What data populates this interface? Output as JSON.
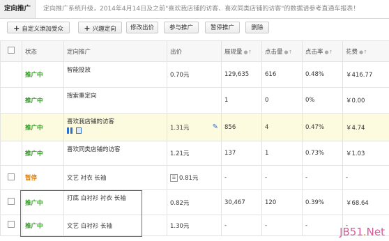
{
  "header": {
    "active_tab": "定向推广",
    "notice": "定向推广系统升级，2014年4月14日及之前\"喜欢我店铺的访客、喜欢同类店铺的访客\"的数据请参考直通车报表！"
  },
  "toolbar": {
    "add_custom": "自定义添加受众",
    "add_interest": "兴趣定向",
    "edit_bid": "修改出价",
    "join": "参与推广",
    "pause": "暂停推广",
    "delete": "删除"
  },
  "table": {
    "headers": [
      "状态",
      "定向推广",
      "出价",
      "展现量",
      "点击量",
      "点击率",
      "花费"
    ],
    "rows": [
      {
        "status": "推广中",
        "status_type": "on",
        "name": "智能投放",
        "bid": "0.70元",
        "impressions": "129,635",
        "clicks": "616",
        "ctr": "0.48%",
        "cost": "￥416.77",
        "checkbox": false
      },
      {
        "status": "推广中",
        "status_type": "on",
        "name": "搜索重定向",
        "bid": "",
        "impressions": "1",
        "clicks": "0",
        "ctr": "0%",
        "cost": "￥0.00",
        "checkbox": false
      },
      {
        "status": "推广中",
        "status_type": "on",
        "name": "喜欢我店铺的访客",
        "bid": "1.31元",
        "impressions": "856",
        "clicks": "4",
        "ctr": "0.47%",
        "cost": "￥4.74",
        "checkbox": false
      },
      {
        "status": "推广中",
        "status_type": "on",
        "name": "喜欢同类店铺的访客",
        "bid": "1.21元",
        "impressions": "137",
        "clicks": "1",
        "ctr": "0.73%",
        "cost": "￥1.03",
        "checkbox": false
      },
      {
        "status": "暂停",
        "status_type": "pause",
        "name": "文艺 衬衣 长袖",
        "bid": "0.81元",
        "impressions": "-",
        "clicks": "-",
        "ctr": "-",
        "cost": "-",
        "checkbox": true
      },
      {
        "status": "推广中",
        "status_type": "on",
        "name": "打底 白衬衫 衬衣 长袖",
        "bid": "0.82元",
        "impressions": "30,467",
        "clicks": "120",
        "ctr": "0.39%",
        "cost": "￥68.64",
        "checkbox": true
      },
      {
        "status": "推广中",
        "status_type": "on",
        "name": "文艺 白衬衫 长袖",
        "bid": "1.30元",
        "impressions": "-",
        "clicks": "-",
        "ctr": "-",
        "cost": "-",
        "checkbox": true
      }
    ]
  },
  "watermark": {
    "prefix": "JB51",
    "dot": ".",
    "suffix": "Net"
  },
  "colors": {
    "status_on": "#2b9a1c",
    "status_pause": "#e07b00",
    "highlight_row": "#fcfbe0",
    "annotation_box": "#e23b3b"
  }
}
